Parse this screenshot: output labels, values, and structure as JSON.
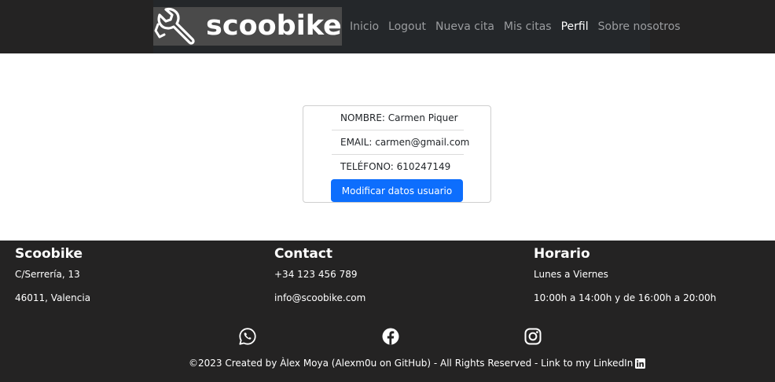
{
  "navbar": {
    "brand": "scoobike",
    "links": [
      "Inicio",
      "Logout",
      "Nueva cita",
      "Mis citas",
      "Perfil",
      "Sobre nosotros"
    ],
    "active": "Perfil",
    "logo_icon": "wrench-icon"
  },
  "profile": {
    "name_line": "NOMBRE: Carmen Piquer",
    "email_line": "EMAIL: carmen@gmail.com",
    "phone_line": "TELÉFONO: 610247149",
    "button_label": "Modificar datos usuario",
    "button_color": "#0d6efd"
  },
  "footer": {
    "company": {
      "title": "Scoobike",
      "line1": "C/Serrería, 13",
      "line2": "46011, Valencia"
    },
    "contact": {
      "title": "Contact",
      "line1": "+34 123 456 789",
      "line2": "info@scoobike.com"
    },
    "hours": {
      "title": "Horario",
      "line1": "Lunes a Viernes",
      "line2": "10:00h a 14:00h y de 16:00h a 20:00h"
    },
    "social_icons": [
      "whatsapp-icon",
      "facebook-icon",
      "instagram-icon"
    ],
    "copyright": "©2023 Created by Àlex Moya (Alexm0u on GitHub) - All Rights Reserved - Link to my LinkedIn",
    "background": "#242323"
  }
}
